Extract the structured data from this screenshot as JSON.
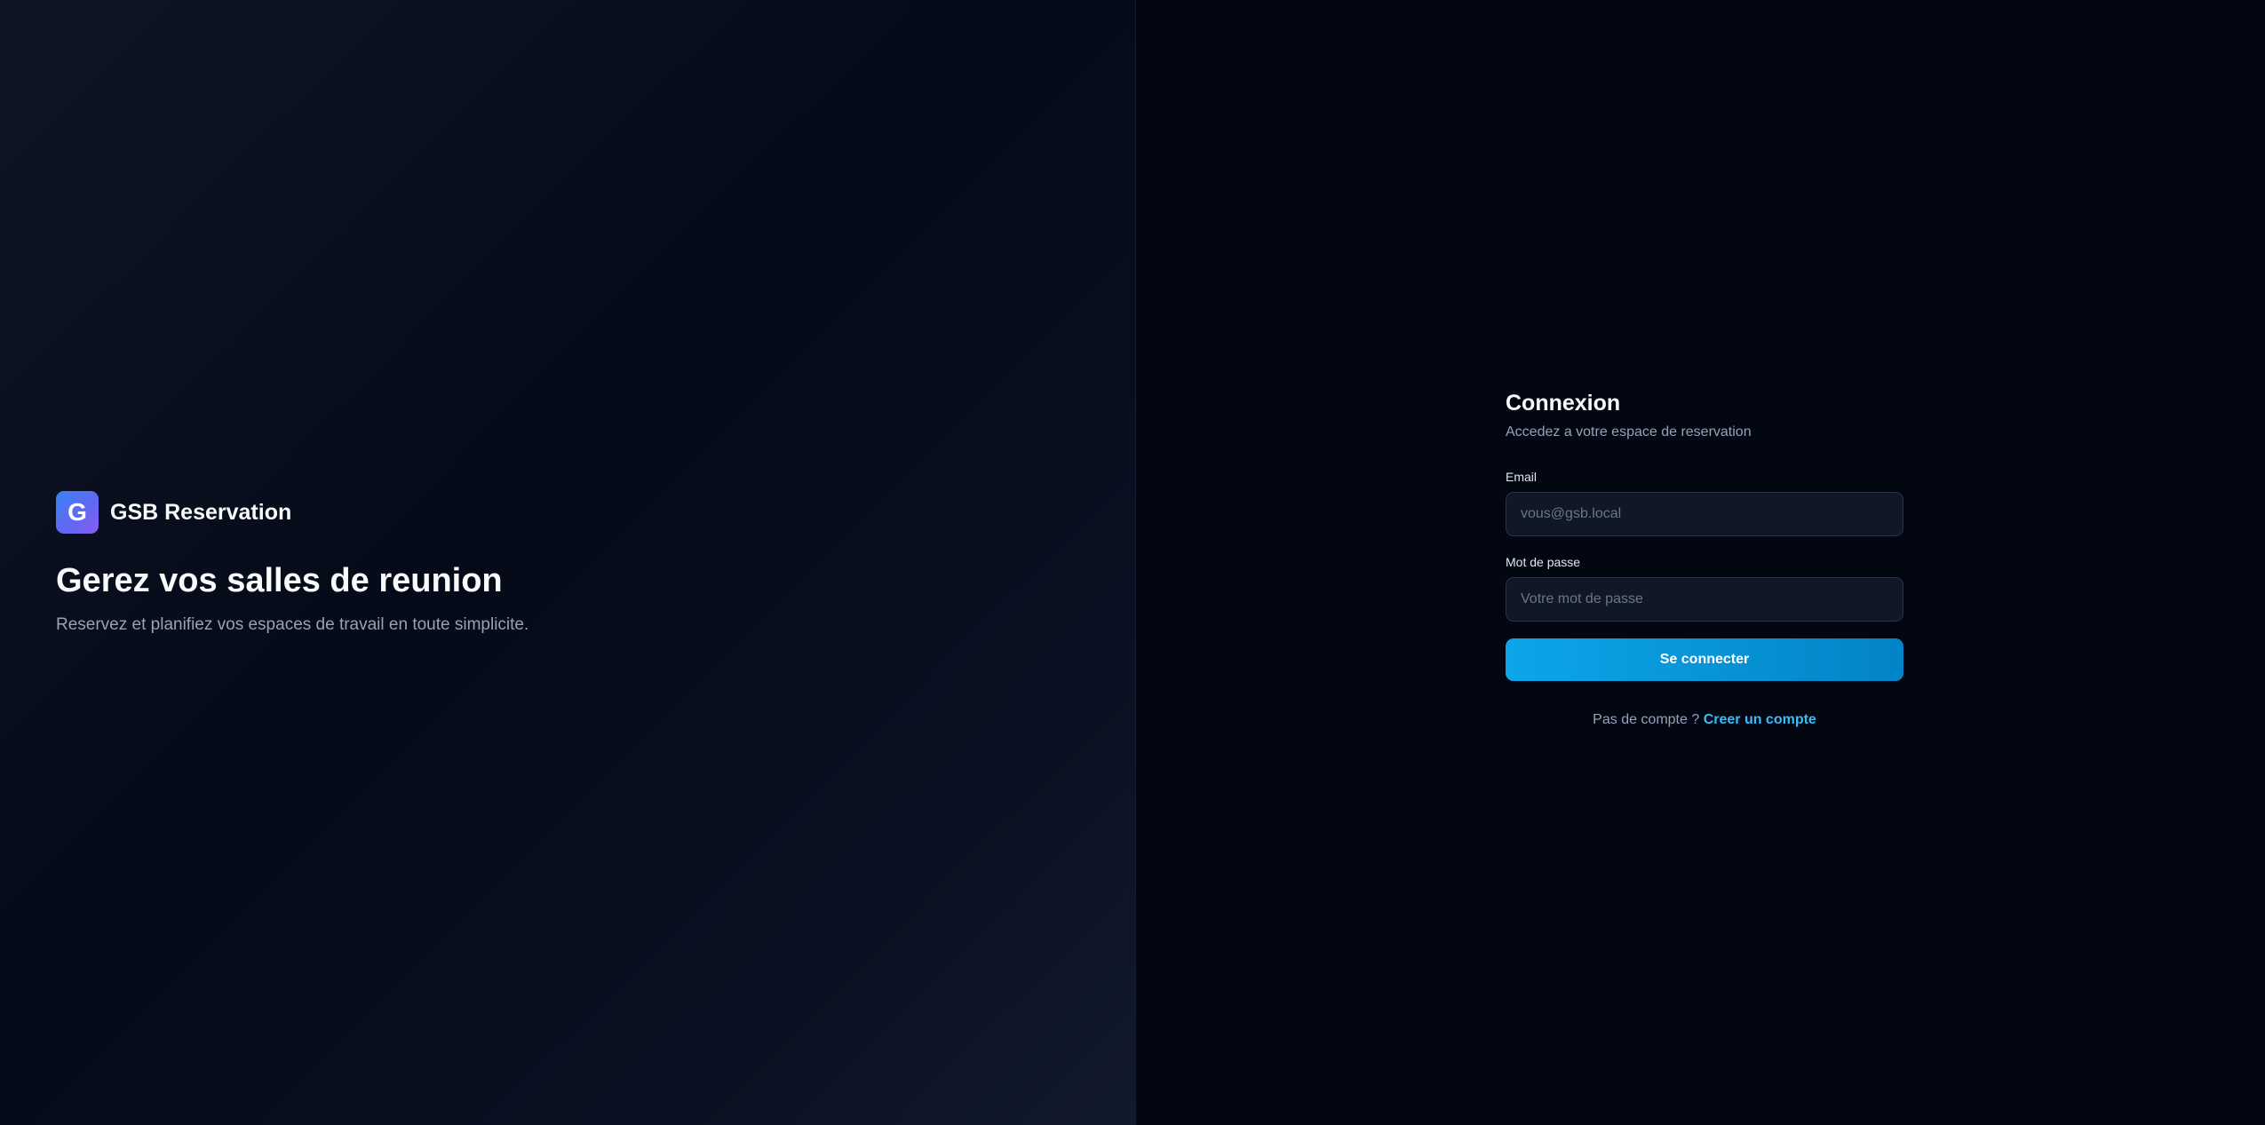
{
  "brand": {
    "logo_letter": "G",
    "name": "GSB Reservation"
  },
  "hero": {
    "title": "Gerez vos salles de reunion",
    "subtitle": "Reservez et planifiez vos espaces de travail en toute simplicite."
  },
  "login": {
    "title": "Connexion",
    "subtitle": "Accedez a votre espace de reservation",
    "email_label": "Email",
    "email_placeholder": "vous@gsb.local",
    "email_value": "",
    "password_label": "Mot de passe",
    "password_placeholder": "Votre mot de passe",
    "password_value": "",
    "submit_label": "Se connecter",
    "signup_prompt": "Pas de compte ?",
    "signup_link": "Creer un compte"
  },
  "colors": {
    "accent": "#0ea5e9",
    "link": "#38bdf8",
    "logo_gradient_start": "#3b82f6",
    "logo_gradient_end": "#8b5cf6",
    "background": "#030712"
  }
}
